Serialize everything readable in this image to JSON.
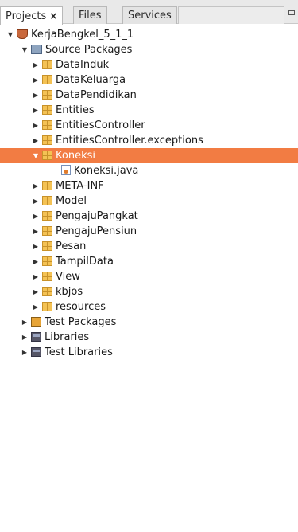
{
  "tabs": [
    {
      "label": "Projects",
      "close": "×",
      "active": true
    },
    {
      "label": "Files",
      "active": false
    },
    {
      "label": "Services",
      "active": false
    }
  ],
  "tree": {
    "project": "KerjaBengkel_5_1_1",
    "source_packages_label": "Source Packages",
    "packages": [
      "DataInduk",
      "DataKeluarga",
      "DataPendidikan",
      "Entities",
      "EntitiesController",
      "EntitiesController.exceptions",
      "Koneksi",
      "META-INF",
      "Model",
      "PengajuPangkat",
      "PengajuPensiun",
      "Pesan",
      "TampilData",
      "View",
      "kbjos",
      "resources"
    ],
    "koneksi_file": "Koneksi.java",
    "test_packages": "Test Packages",
    "libraries": "Libraries",
    "test_libraries": "Test Libraries",
    "selected": "Koneksi"
  },
  "colors": {
    "selection": "#f27c43",
    "package_icon": "#f4c254"
  }
}
